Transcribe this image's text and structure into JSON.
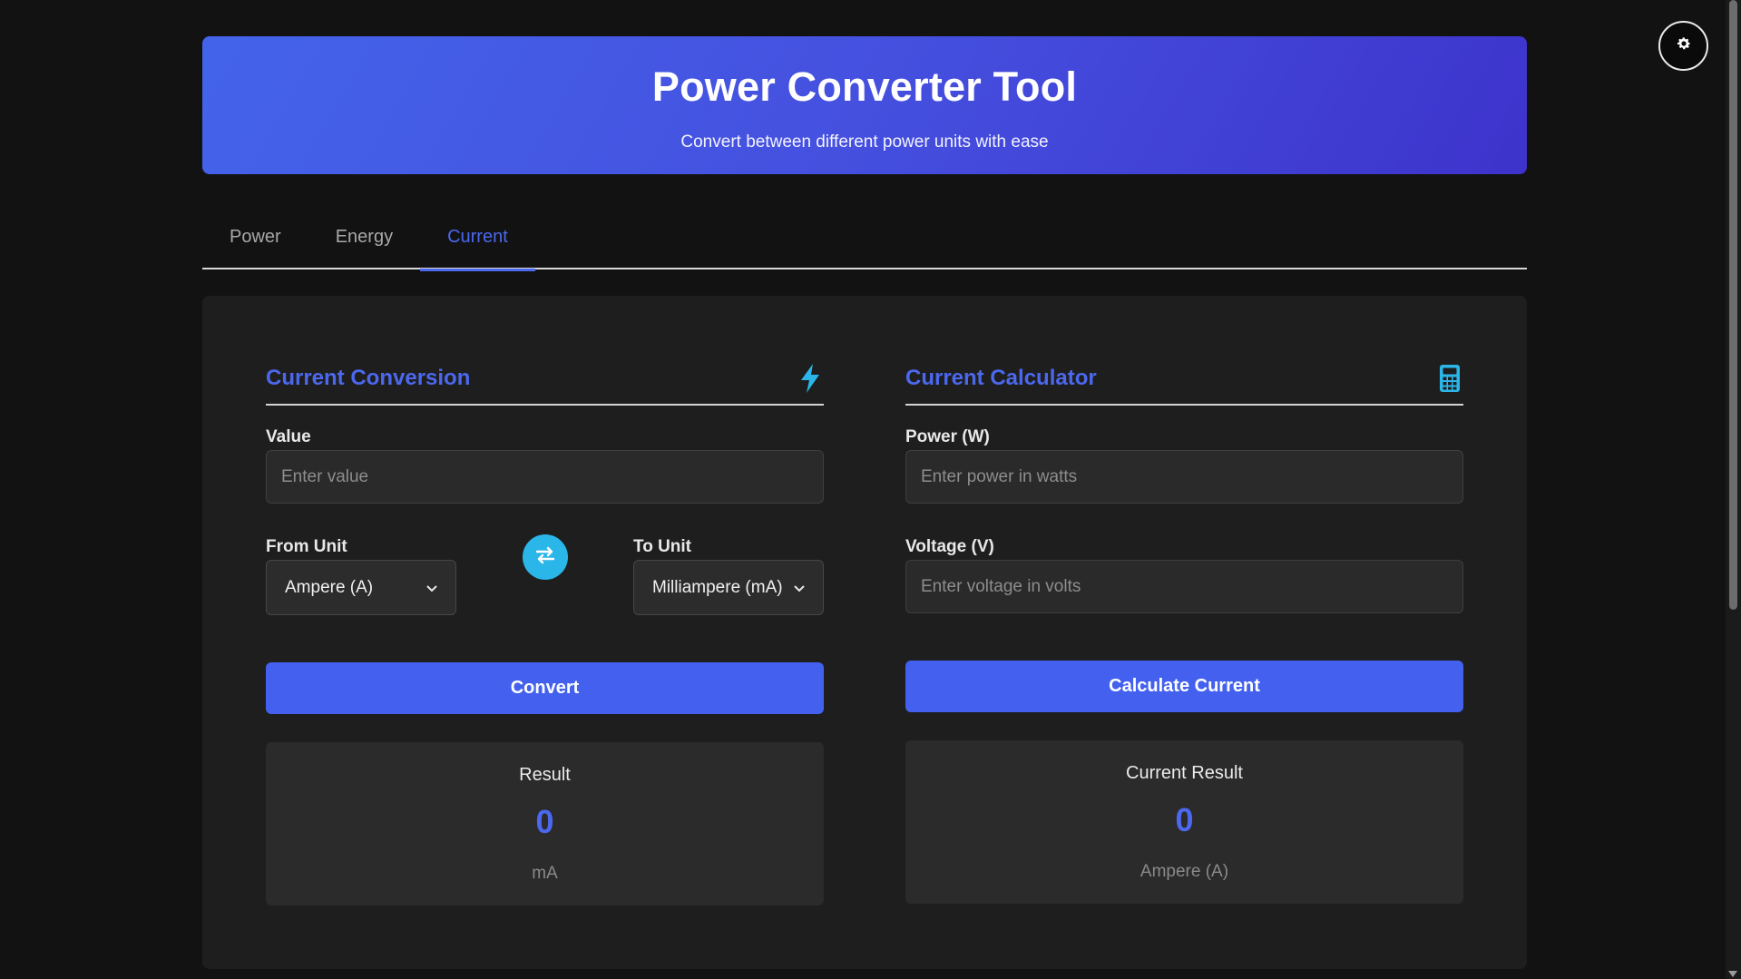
{
  "header": {
    "title": "Power Converter Tool",
    "subtitle": "Convert between different power units with ease"
  },
  "tabs": [
    {
      "label": "Power",
      "active": false
    },
    {
      "label": "Energy",
      "active": false
    },
    {
      "label": "Current",
      "active": true
    }
  ],
  "conversion": {
    "title": "Current Conversion",
    "icon": "lightning-icon",
    "value_label": "Value",
    "value_placeholder": "Enter value",
    "from_label": "From Unit",
    "from_selected": "Ampere (A)",
    "to_label": "To Unit",
    "to_selected": "Milliampere (mA)",
    "convert_label": "Convert",
    "result_title": "Result",
    "result_value": "0",
    "result_unit": "mA"
  },
  "calculator": {
    "title": "Current Calculator",
    "icon": "calculator-icon",
    "power_label": "Power (W)",
    "power_placeholder": "Enter power in watts",
    "voltage_label": "Voltage (V)",
    "voltage_placeholder": "Enter voltage in volts",
    "calculate_label": "Calculate Current",
    "result_title": "Current Result",
    "result_value": "0",
    "result_unit": "Ampere (A)"
  },
  "theme_toggle_icon": "gear-icon",
  "colors": {
    "accent": "#4361ee",
    "swap": "#2bb6ea",
    "background": "#121212",
    "panel": "#1e1e1e"
  }
}
